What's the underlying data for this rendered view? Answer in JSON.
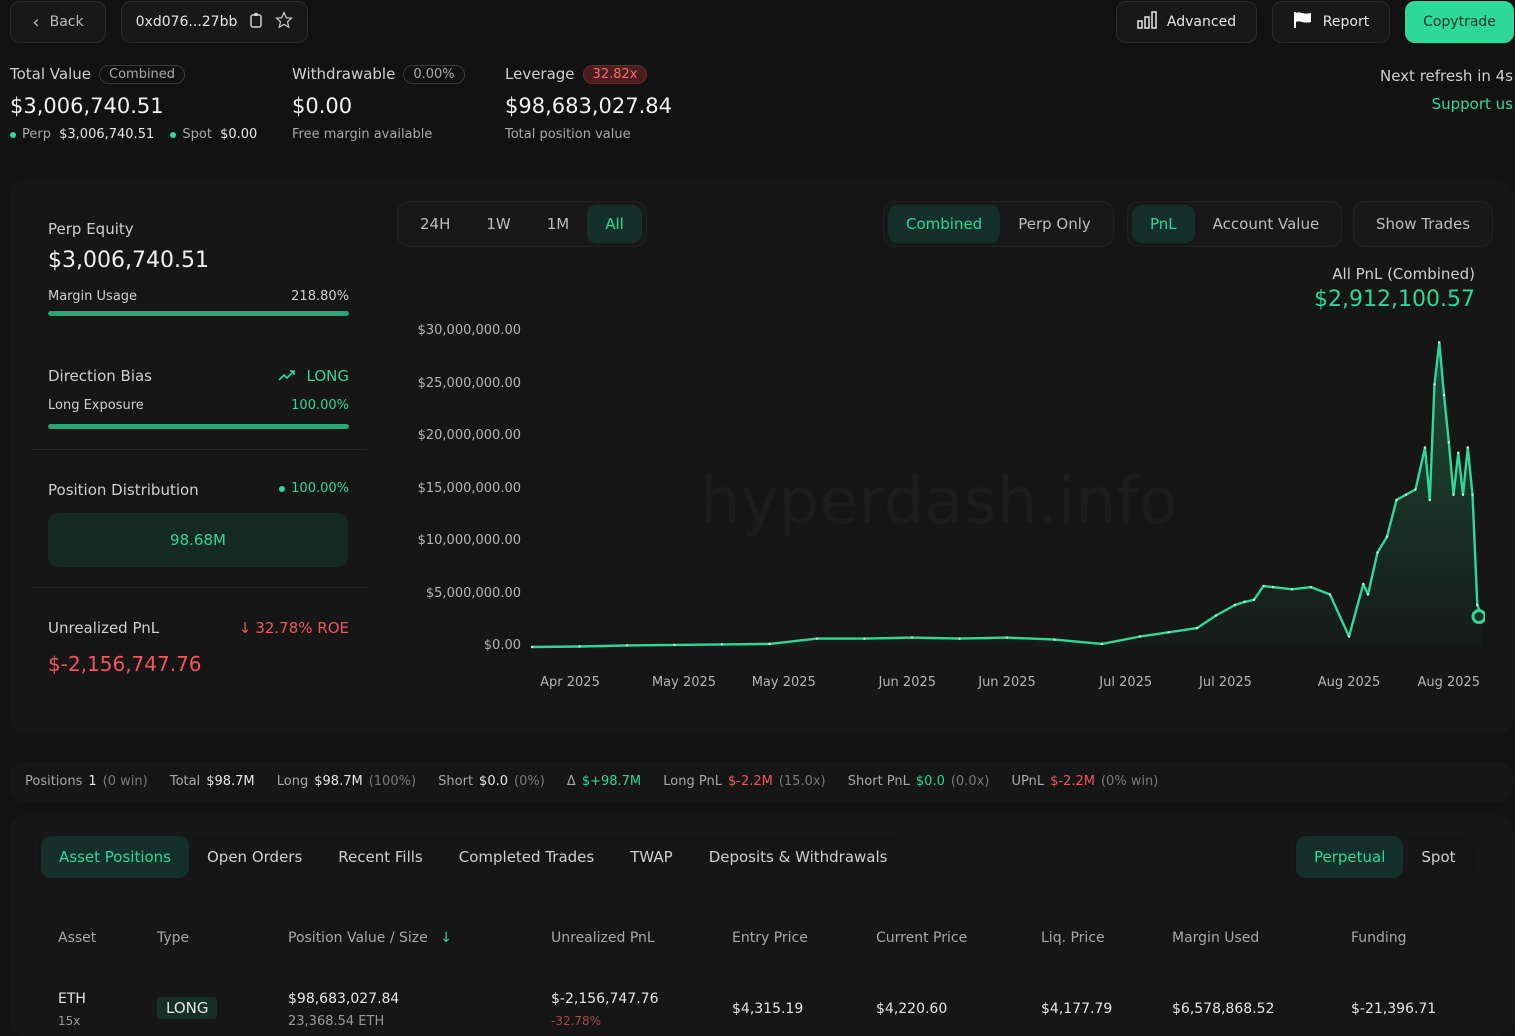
{
  "header": {
    "back_label": "Back",
    "address": "0xd076...27bb",
    "advanced_label": "Advanced",
    "report_label": "Report",
    "copytrade_label": "Copytrade"
  },
  "stats": {
    "total_value": {
      "label": "Total Value",
      "badge": "Combined",
      "value": "$3,006,740.51",
      "perp_label": "Perp",
      "perp_value": "$3,006,740.51",
      "spot_label": "Spot",
      "spot_value": "$0.00"
    },
    "withdrawable": {
      "label": "Withdrawable",
      "badge": "0.00%",
      "value": "$0.00",
      "sub": "Free margin available"
    },
    "leverage": {
      "label": "Leverage",
      "badge": "32.82x",
      "value": "$98,683,027.84",
      "sub": "Total position value"
    },
    "refresh": "Next refresh in 4s",
    "support": "Support us"
  },
  "left_panel": {
    "perp_equity_label": "Perp Equity",
    "perp_equity_value": "$3,006,740.51",
    "margin_usage_label": "Margin Usage",
    "margin_usage_value": "218.80%",
    "margin_usage_fill": 1.0,
    "direction_bias_label": "Direction Bias",
    "direction_bias_value": "LONG",
    "long_exposure_label": "Long Exposure",
    "long_exposure_value": "100.00%",
    "long_exposure_fill": 1.0,
    "position_distribution_label": "Position Distribution",
    "position_distribution_value": "100.00%",
    "distribution_box": "98.68M",
    "unrealized_pnl_label": "Unrealized PnL",
    "roe": "32.78% ROE",
    "unrealized_pnl_value": "$-2,156,747.76"
  },
  "chart_controls": {
    "ranges": [
      "24H",
      "1W",
      "1M",
      "All"
    ],
    "active_range": "All",
    "modes": [
      "Combined",
      "Perp Only"
    ],
    "active_mode": "Combined",
    "metrics": [
      "PnL",
      "Account Value"
    ],
    "active_metric": "PnL",
    "show_trades": "Show Trades",
    "pnl_title": "All PnL (Combined)",
    "pnl_value": "$2,912,100.57",
    "watermark": "hyperdash.info"
  },
  "chart_data": {
    "type": "area",
    "title": "All PnL (Combined)",
    "ylim": [
      0,
      30000000
    ],
    "yticks": [
      "$30,000,000.00",
      "$25,000,000.00",
      "$20,000,000.00",
      "$15,000,000.00",
      "$10,000,000.00",
      "$5,000,000.00",
      "$0.00"
    ],
    "ytick_values": [
      30000000,
      25000000,
      20000000,
      15000000,
      10000000,
      5000000,
      0
    ],
    "xticks": [
      "Apr 2025",
      "May 2025",
      "May 2025",
      "Jun 2025",
      "Jun 2025",
      "Jul 2025",
      "Jul 2025",
      "Aug 2025",
      "Aug 2025"
    ],
    "xtick_pos": [
      0.04,
      0.16,
      0.265,
      0.395,
      0.5,
      0.625,
      0.73,
      0.86,
      0.965
    ],
    "x": [
      0.0,
      0.05,
      0.1,
      0.15,
      0.2,
      0.25,
      0.3,
      0.35,
      0.4,
      0.45,
      0.5,
      0.55,
      0.6,
      0.64,
      0.67,
      0.7,
      0.72,
      0.74,
      0.75,
      0.76,
      0.77,
      0.78,
      0.8,
      0.82,
      0.84,
      0.86,
      0.875,
      0.88,
      0.89,
      0.9,
      0.91,
      0.92,
      0.93,
      0.94,
      0.945,
      0.95,
      0.955,
      0.96,
      0.965,
      0.97,
      0.975,
      0.98,
      0.985,
      0.99,
      0.995,
      1.0
    ],
    "values": [
      0,
      50000,
      150000,
      200000,
      250000,
      300000,
      800000,
      800000,
      900000,
      800000,
      900000,
      700000,
      300000,
      1000000,
      1400000,
      1800000,
      3000000,
      4000000,
      4300000,
      4500000,
      5800000,
      5700000,
      5500000,
      5700000,
      5000000,
      1000000,
      6000000,
      5000000,
      9000000,
      10500000,
      14000000,
      14500000,
      15000000,
      19000000,
      14000000,
      25000000,
      29000000,
      24000000,
      19500000,
      14500000,
      18500000,
      14500000,
      19000000,
      14500000,
      4000000,
      2900000
    ]
  },
  "summary": {
    "positions_label": "Positions",
    "positions_value": "1",
    "positions_win": "(0 win)",
    "total_label": "Total",
    "total_value": "$98.7M",
    "long_label": "Long",
    "long_value": "$98.7M",
    "long_pct": "(100%)",
    "short_label": "Short",
    "short_value": "$0.0",
    "short_pct": "(0%)",
    "delta_label": "Δ",
    "delta_value": "$+98.7M",
    "long_pnl_label": "Long PnL",
    "long_pnl_value": "$-2.2M",
    "long_pnl_lev": "(15.0x)",
    "short_pnl_label": "Short PnL",
    "short_pnl_value": "$0.0",
    "short_pnl_lev": "(0.0x)",
    "upnl_label": "UPnL",
    "upnl_value": "$-2.2M",
    "upnl_win": "(0% win)"
  },
  "tabs": {
    "items": [
      "Asset Positions",
      "Open Orders",
      "Recent Fills",
      "Completed Trades",
      "TWAP",
      "Deposits & Withdrawals"
    ],
    "active": "Asset Positions",
    "market": [
      "Perpetual",
      "Spot"
    ],
    "active_market": "Perpetual"
  },
  "table": {
    "headers": [
      "Asset",
      "Type",
      "Position Value / Size",
      "Unrealized PnL",
      "Entry Price",
      "Current Price",
      "Liq. Price",
      "Margin Used",
      "Funding"
    ],
    "rows": [
      {
        "asset": "ETH",
        "leverage": "15x",
        "type": "LONG",
        "position_value": "$98,683,027.84",
        "size": "23,368.54 ETH",
        "upnl": "$-2,156,747.76",
        "upnl_pct": "-32.78%",
        "entry": "$4,315.19",
        "current": "$4,220.60",
        "liq": "$4,177.79",
        "margin": "$6,578,868.52",
        "funding": "$-21,396.71"
      }
    ]
  },
  "colors": {
    "accent": "#2ed896",
    "negative": "#f0565d",
    "background": "#121212"
  }
}
